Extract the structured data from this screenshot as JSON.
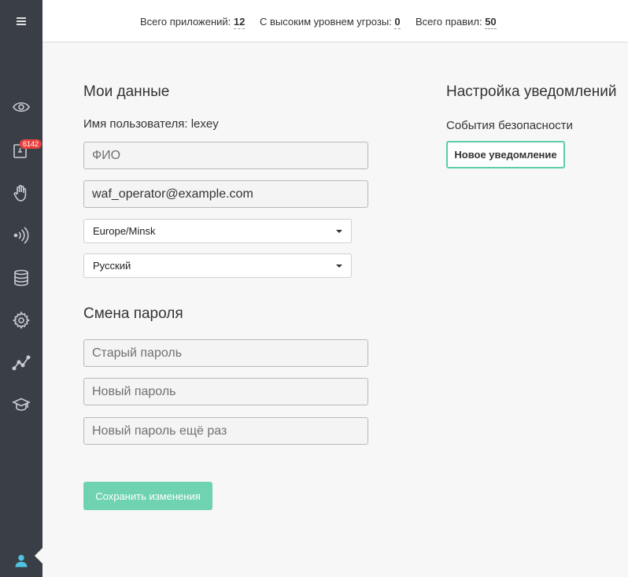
{
  "topbar": {
    "stats": [
      {
        "label": "Всего приложений:",
        "value": "12"
      },
      {
        "label": "С высоким уровнем угрозы:",
        "value": "0"
      },
      {
        "label": "Всего правил:",
        "value": "50"
      }
    ]
  },
  "sidebar": {
    "alerts_badge": "6142",
    "icons": [
      "menu-icon",
      "eye-icon",
      "alerts-icon",
      "hand-icon",
      "signal-icon",
      "database-icon",
      "gear-icon",
      "chart-icon",
      "graduation-cap-icon",
      "user-icon"
    ]
  },
  "profile": {
    "title": "Мои данные",
    "username_label": "Имя пользователя: lexey",
    "fullname_placeholder": "ФИО",
    "email_value": "waf_operator@example.com",
    "timezone": "Europe/Minsk",
    "language": "Русский"
  },
  "password": {
    "title": "Смена пароля",
    "old_placeholder": "Старый пароль",
    "new_placeholder": "Новый пароль",
    "repeat_placeholder": "Новый пароль ещё раз"
  },
  "notifications": {
    "title": "Настройка уведомлений",
    "subtitle": "События безопасности",
    "new_button": "Новое уведомление"
  },
  "actions": {
    "save_label": "Сохранить изменения"
  },
  "colors": {
    "sidebar_bg": "#3a3f47",
    "accent": "#5ccda8",
    "badge": "#e8423f",
    "user_icon": "#4fc3e0"
  }
}
